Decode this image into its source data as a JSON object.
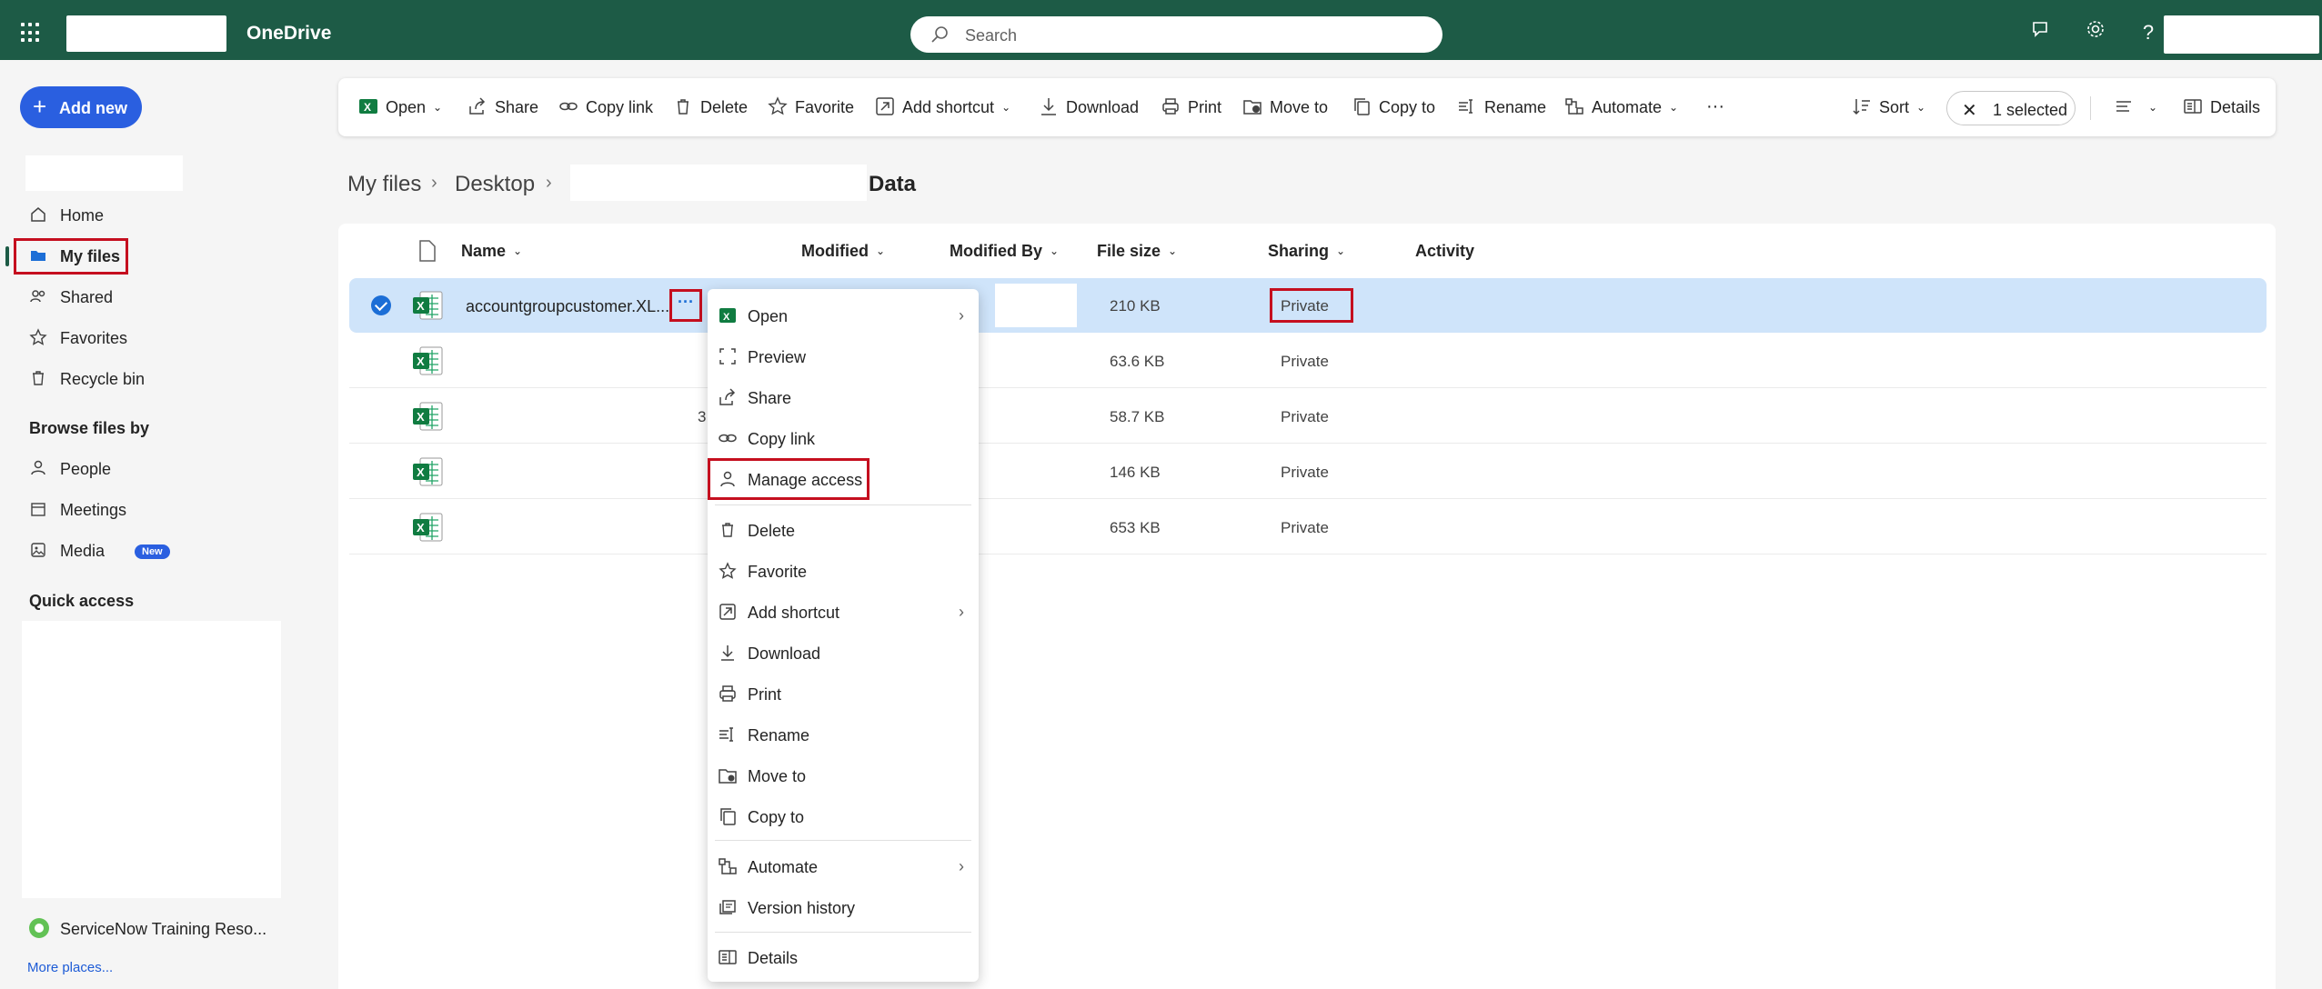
{
  "topbar": {
    "app_name": "OneDrive",
    "search_placeholder": "Search",
    "colors": {
      "bar": "#1d5b46",
      "accent": "#2a5fe0",
      "highlight": "#c50f1f"
    }
  },
  "sidebar": {
    "add_new_label": "Add new",
    "items": [
      {
        "label": "Home",
        "icon": "home-icon"
      },
      {
        "label": "My files",
        "icon": "folder-icon"
      },
      {
        "label": "Shared",
        "icon": "people-icon"
      },
      {
        "label": "Favorites",
        "icon": "star-icon"
      },
      {
        "label": "Recycle bin",
        "icon": "trash-icon"
      }
    ],
    "browse_heading": "Browse files by",
    "browse_items": [
      {
        "label": "People",
        "icon": "person-icon"
      },
      {
        "label": "Meetings",
        "icon": "calendar-icon"
      },
      {
        "label": "Media",
        "icon": "image-icon",
        "badge": "New"
      }
    ],
    "quick_access_heading": "Quick access",
    "service_item": "ServiceNow Training Reso...",
    "more_places": "More places..."
  },
  "commandbar": {
    "open": "Open",
    "share": "Share",
    "copy_link": "Copy link",
    "delete": "Delete",
    "favorite": "Favorite",
    "add_shortcut": "Add shortcut",
    "download": "Download",
    "print": "Print",
    "move_to": "Move to",
    "copy_to": "Copy to",
    "rename": "Rename",
    "automate": "Automate",
    "more": "···",
    "sort": "Sort",
    "selected": "1 selected",
    "details": "Details"
  },
  "breadcrumb": {
    "items": [
      "My files",
      "Desktop"
    ],
    "last": "Data"
  },
  "filelist": {
    "columns": {
      "name": "Name",
      "modified": "Modified",
      "modified_by": "Modified By",
      "file_size": "File size",
      "sharing": "Sharing",
      "activity": "Activity"
    },
    "rows": [
      {
        "name": "accountgroupcustomer.XL...",
        "size": "210 KB",
        "sharing": "Private",
        "extra": ""
      },
      {
        "name": "",
        "size": "63.6 KB",
        "sharing": "Private",
        "extra": ""
      },
      {
        "name": "",
        "size": "58.7 KB",
        "sharing": "Private",
        "extra": "3"
      },
      {
        "name": "",
        "size": "146 KB",
        "sharing": "Private",
        "extra": ""
      },
      {
        "name": "",
        "size": "653 KB",
        "sharing": "Private",
        "extra": ""
      }
    ],
    "more_button": "···"
  },
  "context_menu": {
    "items": [
      "Open",
      "Preview",
      "Share",
      "Copy link",
      "Manage access",
      "Delete",
      "Favorite",
      "Add shortcut",
      "Download",
      "Print",
      "Rename",
      "Move to",
      "Copy to",
      "Automate",
      "Version history",
      "Details"
    ]
  }
}
